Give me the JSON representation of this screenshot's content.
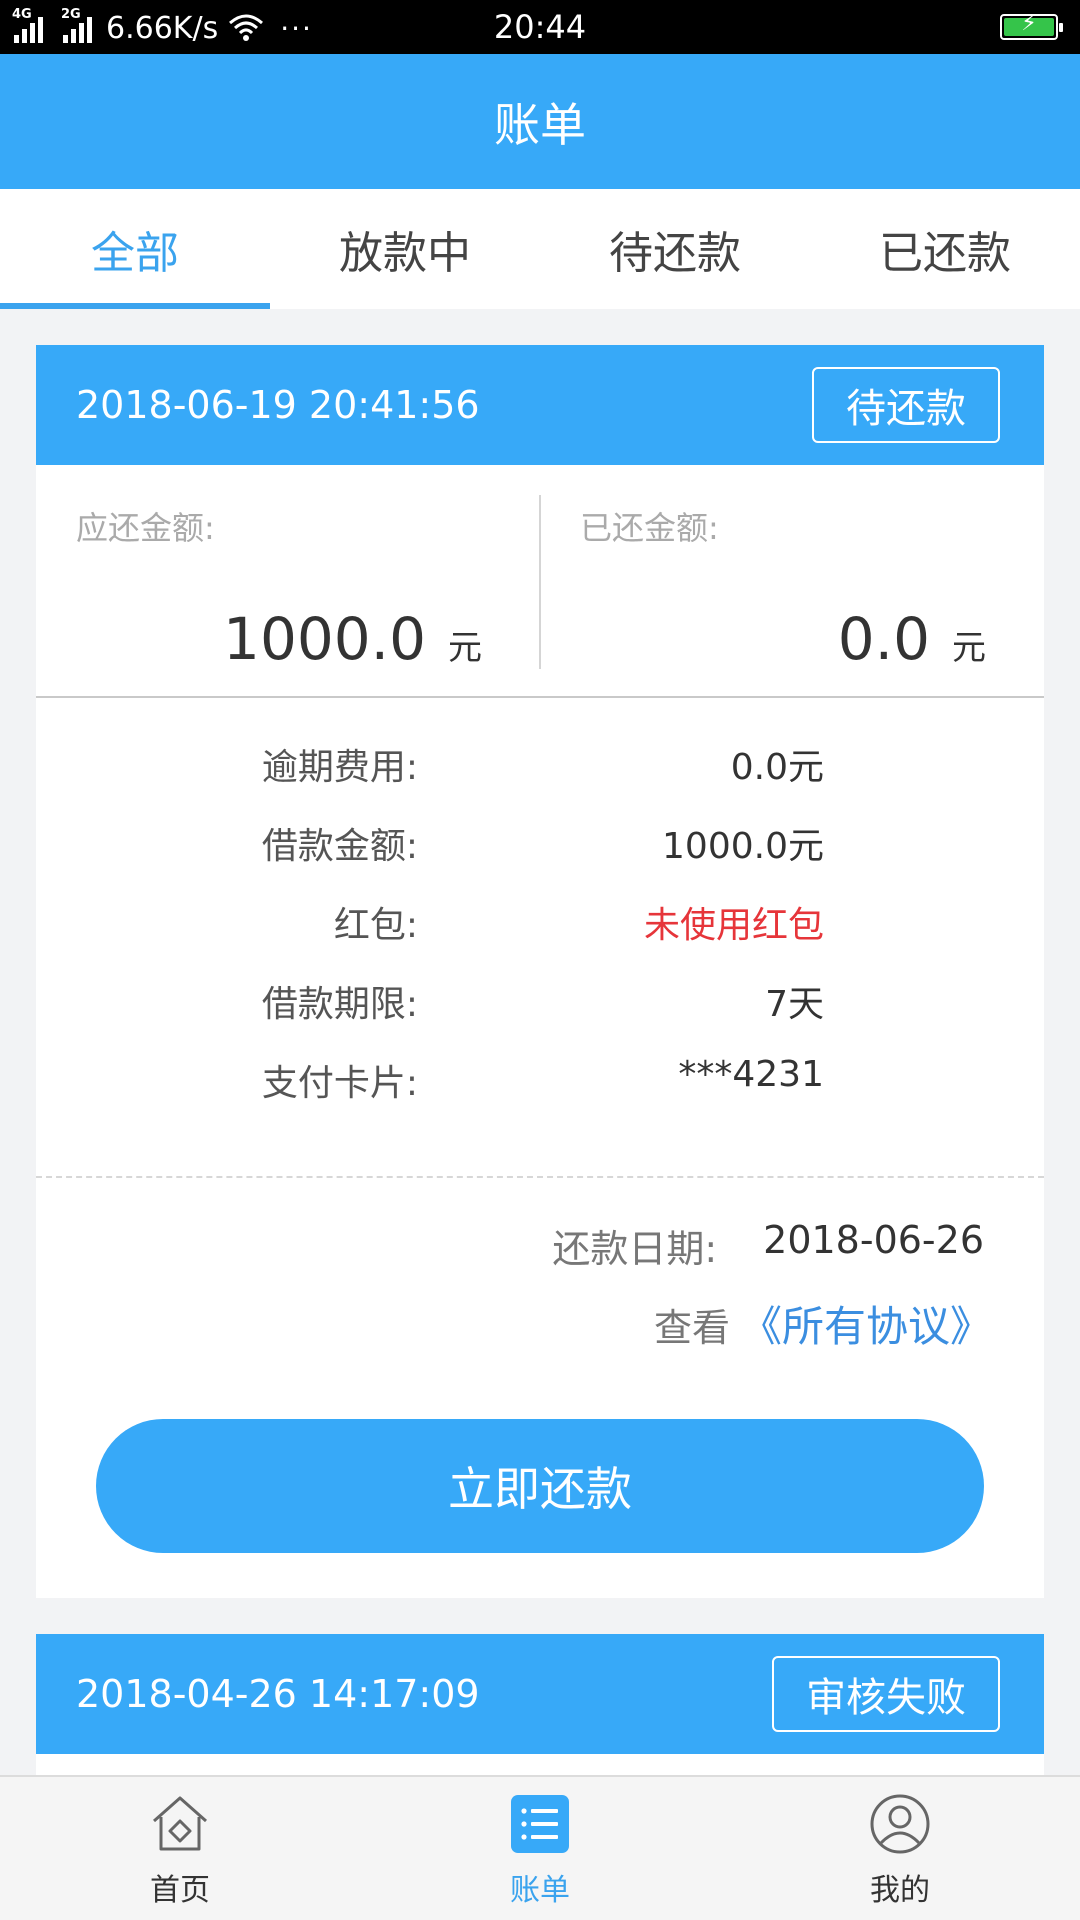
{
  "status_bar": {
    "net1": "4G",
    "net2": "2G",
    "speed": "6.66K/s",
    "dots": "···",
    "time": "20:44"
  },
  "header": {
    "title": "账单"
  },
  "tabs": [
    {
      "label": "全部",
      "active": true
    },
    {
      "label": "放款中",
      "active": false
    },
    {
      "label": "待还款",
      "active": false
    },
    {
      "label": "已还款",
      "active": false
    }
  ],
  "bills": [
    {
      "datetime": "2018-06-19 20:41:56",
      "status": "待还款",
      "due_label": "应还金额:",
      "due_amount": "1000.0",
      "paid_label": "已还金额:",
      "paid_amount": "0.0",
      "unit": "元",
      "details": [
        {
          "label": "逾期费用:",
          "value": "0.0元"
        },
        {
          "label": "借款金额:",
          "value": "1000.0元"
        },
        {
          "label": "红包:",
          "value": "未使用红包",
          "highlight": true
        },
        {
          "label": "借款期限:",
          "value": "7天"
        },
        {
          "label": "支付卡片:",
          "value": "***4231"
        }
      ],
      "repay_date_label": "还款日期:",
      "repay_date": "2018-06-26",
      "view_label": "查看",
      "agreement_link": "《所有协议》",
      "pay_button": "立即还款"
    },
    {
      "datetime": "2018-04-26 14:17:09",
      "status": "审核失败"
    }
  ],
  "bottom_nav": [
    {
      "label": "首页",
      "icon": "home-icon",
      "active": false
    },
    {
      "label": "账单",
      "icon": "bill-list-icon",
      "active": true
    },
    {
      "label": "我的",
      "icon": "user-icon",
      "active": false
    }
  ],
  "colors": {
    "primary": "#37a9f8",
    "tab_active": "#3aa3ee",
    "highlight_red": "#e6353a",
    "link_blue": "#3b8ee0",
    "battery_green": "#35c44a"
  }
}
